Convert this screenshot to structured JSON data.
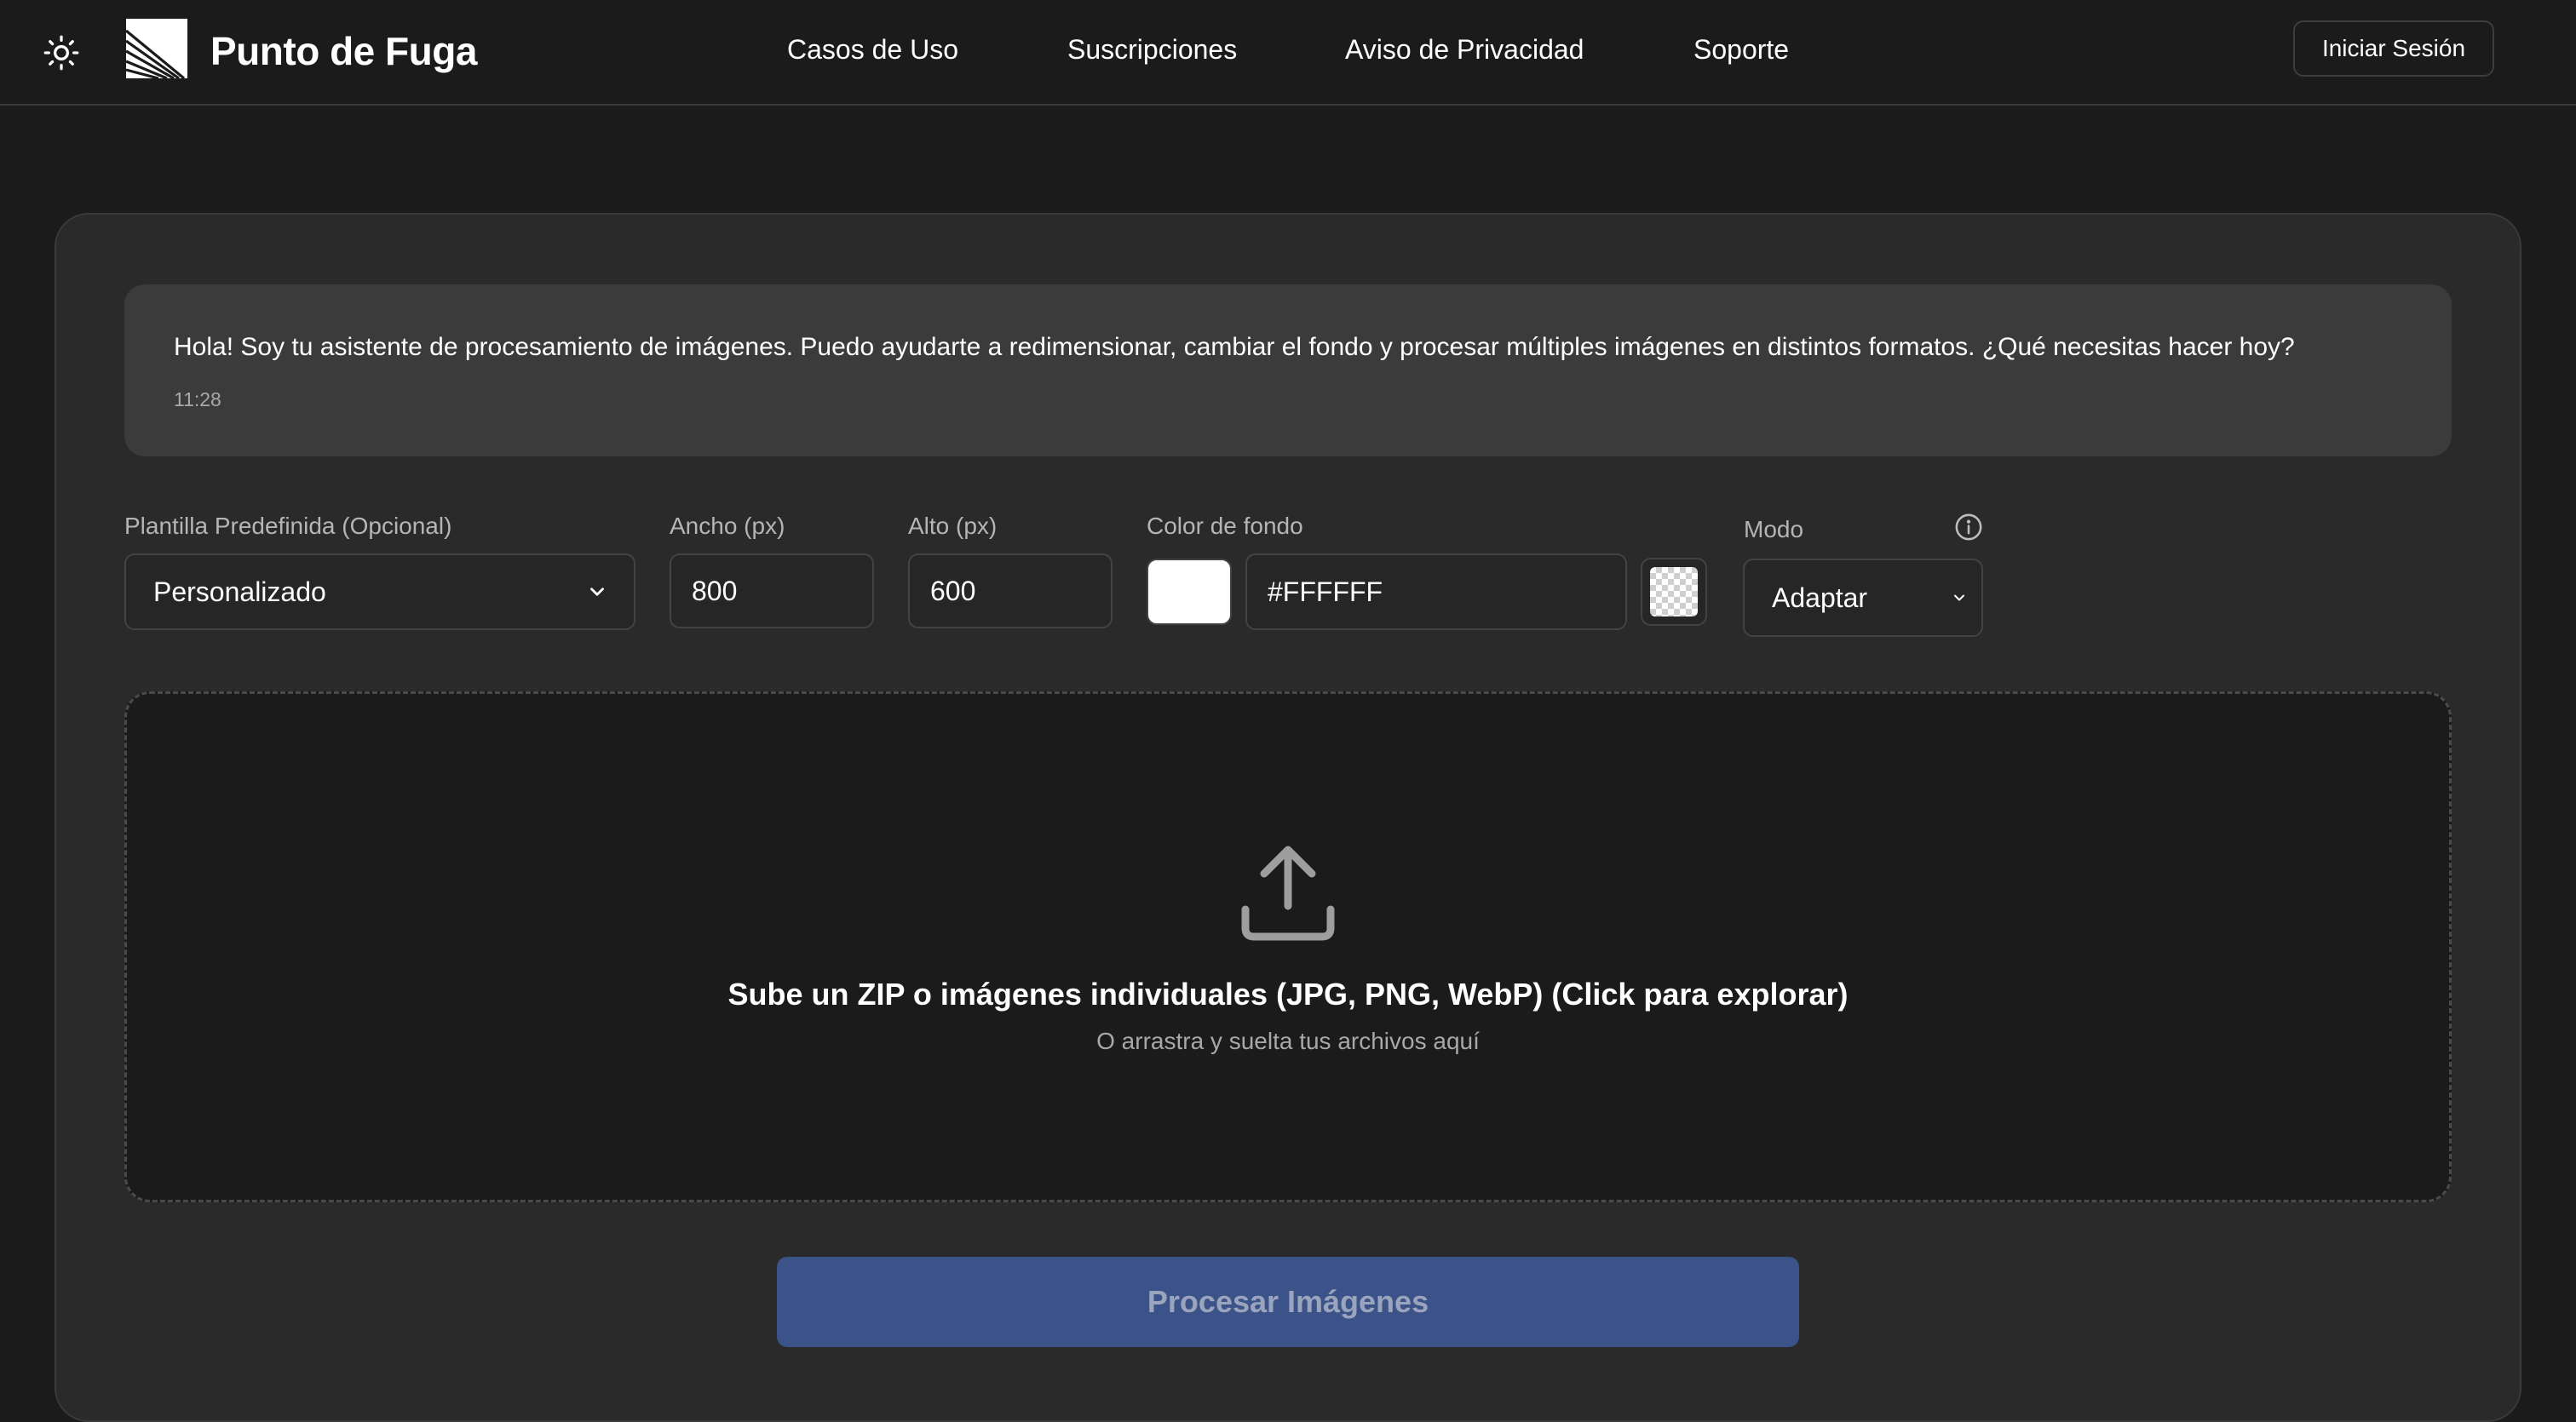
{
  "header": {
    "brand": "Punto de Fuga",
    "nav": [
      {
        "label": "Casos de Uso"
      },
      {
        "label": "Suscripciones"
      },
      {
        "label": "Aviso de Privacidad"
      },
      {
        "label": "Soporte"
      }
    ],
    "login_label": "Iniciar Sesión",
    "theme_icon": "sun-icon"
  },
  "chat": {
    "message": "Hola! Soy tu asistente de procesamiento de imágenes. Puedo ayudarte a redimensionar, cambiar el fondo y procesar múltiples imágenes en distintos formatos. ¿Qué necesitas hacer hoy?",
    "time": "11:28"
  },
  "form": {
    "template": {
      "label": "Plantilla Predefinida (Opcional)",
      "value": "Personalizado"
    },
    "width": {
      "label": "Ancho (px)",
      "value": "800"
    },
    "height": {
      "label": "Alto (px)",
      "value": "600"
    },
    "background": {
      "label": "Color de fondo",
      "value": "#FFFFFF",
      "swatch_color": "#FFFFFF"
    },
    "mode": {
      "label": "Modo",
      "value": "Adaptar"
    }
  },
  "dropzone": {
    "title": "Sube un ZIP o imágenes individuales (JPG, PNG, WebP) (Click para explorar)",
    "subtitle": "O arrastra y suelta tus archivos aquí",
    "icon": "upload-icon"
  },
  "actions": {
    "process_label": "Procesar Imágenes"
  },
  "colors": {
    "background": "#1b1b1b",
    "card": "#2a2a2a",
    "message_bubble": "#3b3b3b",
    "primary_button": "#3c5389"
  }
}
